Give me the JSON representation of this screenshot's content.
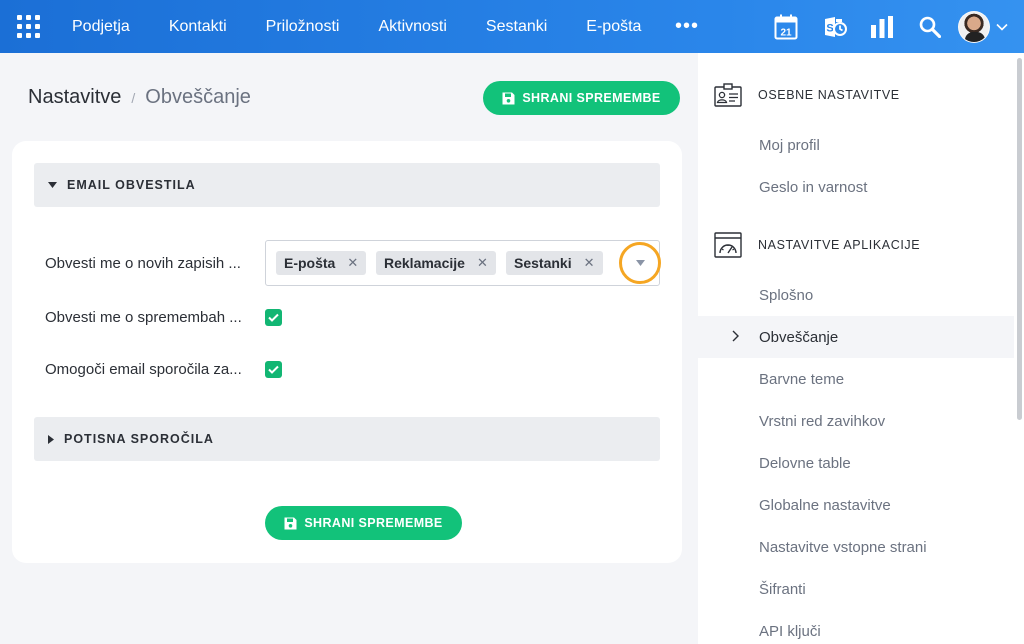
{
  "topbar": {
    "nav": [
      "Podjetja",
      "Kontakti",
      "Priložnosti",
      "Aktivnosti",
      "Sestanki",
      "E-pošta"
    ],
    "more": "•••",
    "calendar_day": "21",
    "icons": [
      "apps-grid-icon",
      "calendar-icon",
      "skype-icon",
      "analytics-icon",
      "search-icon"
    ]
  },
  "breadcrumb": {
    "root": "Nastavitve",
    "separator": "/",
    "current": "Obveščanje"
  },
  "save_label": "SHRANI SPREMEMBE",
  "sections": {
    "email": {
      "title": "EMAIL OBVESTILA",
      "rows": [
        {
          "label": "Obvesti me o novih zapisih ..."
        },
        {
          "label": "Obvesti me o spremembah ...",
          "checked": true
        },
        {
          "label": "Omogoči email sporočila za...",
          "checked": true
        }
      ],
      "tags": [
        "E-pošta",
        "Reklamacije",
        "Sestanki"
      ]
    },
    "push": {
      "title": "POTISNA SPOROČILA"
    }
  },
  "sidebar": {
    "personal": {
      "title": "OSEBNE NASTAVITVE",
      "items": [
        "Moj profil",
        "Geslo in varnost"
      ]
    },
    "app": {
      "title": "NASTAVITVE APLIKACIJE",
      "items": [
        "Splošno",
        "Obveščanje",
        "Barvne teme",
        "Vrstni red zavihkov",
        "Delovne table",
        "Globalne nastavitve",
        "Nastavitve vstopne strani",
        "Šifranti",
        "API ključi"
      ],
      "active": "Obveščanje"
    }
  },
  "colors": {
    "topbar": "#1b6fd6",
    "accent_green": "#12c27a",
    "highlight_ring": "#f5a623"
  }
}
